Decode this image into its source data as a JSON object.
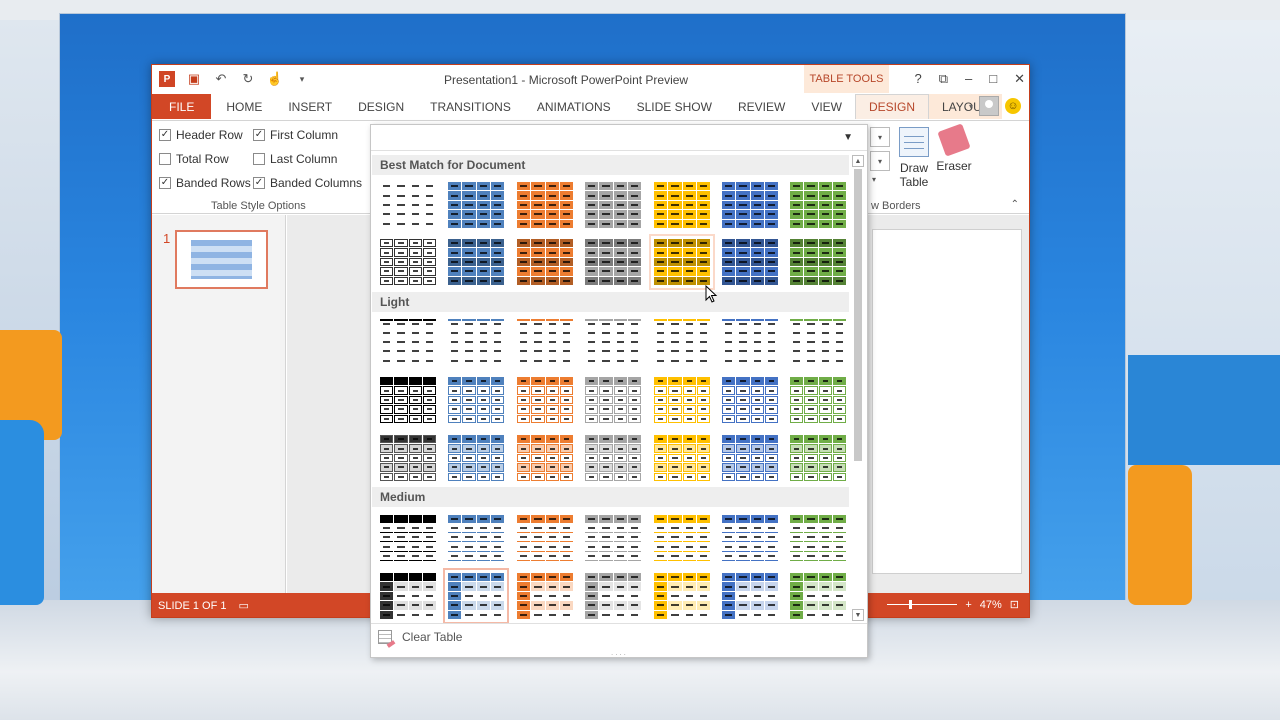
{
  "window": {
    "title": "Presentation1 - Microsoft PowerPoint Preview",
    "context_tab_group": "TABLE TOOLS",
    "controls": [
      "?",
      "⧉",
      "–",
      "□",
      "✕"
    ]
  },
  "qat": {
    "icons": [
      "powerpoint-logo",
      "save-icon",
      "undo-icon",
      "redo-icon",
      "touch-mode-icon",
      "customize-icon"
    ]
  },
  "tabs": [
    {
      "label": "FILE"
    },
    {
      "label": "HOME"
    },
    {
      "label": "INSERT"
    },
    {
      "label": "DESIGN"
    },
    {
      "label": "TRANSITIONS"
    },
    {
      "label": "ANIMATIONS"
    },
    {
      "label": "SLIDE SHOW"
    },
    {
      "label": "REVIEW"
    },
    {
      "label": "VIEW"
    },
    {
      "label": "DESIGN"
    },
    {
      "label": "LAYOUT"
    }
  ],
  "table_style_options": {
    "header_row": {
      "label": "Header Row",
      "checked": true
    },
    "first_column": {
      "label": "First Column",
      "checked": true
    },
    "total_row": {
      "label": "Total Row",
      "checked": false
    },
    "last_column": {
      "label": "Last Column",
      "checked": false
    },
    "banded_rows": {
      "label": "Banded Rows",
      "checked": true
    },
    "banded_columns": {
      "label": "Banded Columns",
      "checked": true
    },
    "group_label": "Table Style Options"
  },
  "draw_borders": {
    "draw_table": "Draw\nTable",
    "draw_table_line1": "Draw",
    "draw_table_line2": "Table",
    "eraser": "Eraser",
    "group_label_partial": "w Borders"
  },
  "slides_pane": {
    "slide_number": "1"
  },
  "gallery": {
    "sections": [
      {
        "title": "Best Match for Document"
      },
      {
        "title": "Light"
      },
      {
        "title": "Medium"
      }
    ],
    "clear_table": "Clear Table",
    "grip": "....",
    "colors": [
      "#ffffff",
      "#4f81bd",
      "#ed7d31",
      "#a5a5a5",
      "#ffc000",
      "#4472c4",
      "#70ad47"
    ]
  },
  "statusbar": {
    "slide_info": "SLIDE 1 OF 1",
    "zoom": "47%"
  }
}
